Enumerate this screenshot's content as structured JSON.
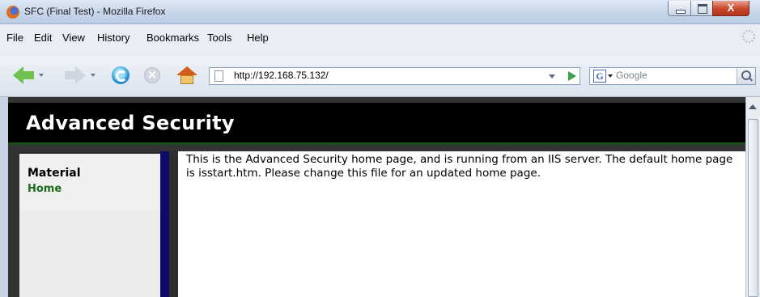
{
  "window": {
    "title": "SFC (Final Test) - Mozilla Firefox",
    "controls": {
      "minimize": "minimize",
      "maximize": "maximize",
      "close": "X"
    }
  },
  "menu": {
    "items": [
      "File",
      "Edit",
      "View",
      "History",
      "Bookmarks",
      "Tools",
      "Help"
    ]
  },
  "navigation": {
    "url": "http://192.168.75.132/",
    "search_placeholder": "Google",
    "search_engine_letter": "G"
  },
  "page": {
    "site_title": "Advanced Security",
    "sidebar": {
      "heading": "Material",
      "links": [
        "Home"
      ]
    },
    "main_text": "This is the Advanced Security home page, and is running from an IIS server. The default home page is isstart.htm. Please change this file for an updated home page."
  },
  "colors": {
    "header_bg": "#000000",
    "header_border": "#1c4f1c",
    "sidebar_link": "#1c6b1c",
    "sidebar_divider": "#0b0c6a",
    "page_frame": "#333333"
  },
  "icons": {
    "browser": "firefox-icon",
    "back": "back-arrow-icon",
    "forward": "forward-arrow-icon",
    "reload": "reload-icon",
    "stop": "stop-icon",
    "home": "home-icon",
    "page": "page-icon",
    "go": "go-arrow-icon",
    "search": "magnifier-icon",
    "activity": "throbber-icon"
  }
}
